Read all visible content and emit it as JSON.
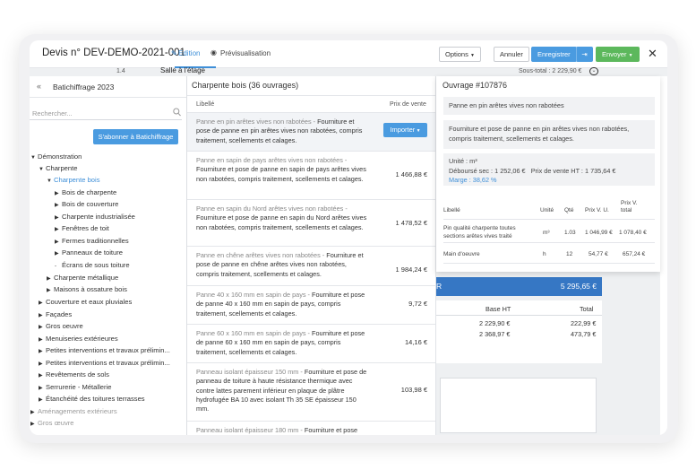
{
  "header": {
    "title": "Devis n° DEV-DEMO-2021-001",
    "tab_edit": "Edition",
    "tab_preview": "Prévisualisation",
    "options": "Options",
    "cancel": "Annuler",
    "save": "Enregistrer",
    "send": "Envoyer"
  },
  "background": {
    "line_num": "1.4",
    "section": "Salle à l'étage",
    "subtotal": "Sous-total : 2 229,90 €",
    "total_value": "5 295,65 €",
    "total_letter": "R",
    "col_base": "Base HT",
    "col_total": "Total",
    "rows": [
      {
        "base": "2 229,90 €",
        "total": "222,99 €"
      },
      {
        "base": "2 368,97 €",
        "total": "473,79 €"
      }
    ]
  },
  "library": {
    "title": "Batichiffrage 2023",
    "search_placeholder": "Rechercher...",
    "subscribe": "S'abonner à Batichiffrage",
    "tree": [
      {
        "label": "Démonstration",
        "caret": "▼",
        "level": 0
      },
      {
        "label": "Charpente",
        "caret": "▼",
        "level": 1
      },
      {
        "label": "Charpente bois",
        "caret": "▼",
        "level": 2,
        "selected": true
      },
      {
        "label": "Bois de charpente",
        "caret": "▶",
        "level": 3
      },
      {
        "label": "Bois de couverture",
        "caret": "▶",
        "level": 3
      },
      {
        "label": "Charpente industrialisée",
        "caret": "▶",
        "level": 3
      },
      {
        "label": "Fenêtres de toit",
        "caret": "▶",
        "level": 3
      },
      {
        "label": "Fermes traditionnelles",
        "caret": "▶",
        "level": 3
      },
      {
        "label": "Panneaux de toiture",
        "caret": "▶",
        "level": 3
      },
      {
        "label": "Écrans de sous toiture",
        "caret": "-",
        "level": 3
      },
      {
        "label": "Charpente métallique",
        "caret": "▶",
        "level": 2
      },
      {
        "label": "Maisons à ossature bois",
        "caret": "▶",
        "level": 2
      },
      {
        "label": "Couverture et eaux pluviales",
        "caret": "▶",
        "level": 1
      },
      {
        "label": "Façades",
        "caret": "▶",
        "level": 1
      },
      {
        "label": "Gros oeuvre",
        "caret": "▶",
        "level": 1
      },
      {
        "label": "Menuiseries extérieures",
        "caret": "▶",
        "level": 1
      },
      {
        "label": "Petites interventions et travaux prélimin...",
        "caret": "▶",
        "level": 1
      },
      {
        "label": "Petites interventions et travaux prélimin...",
        "caret": "▶",
        "level": 1
      },
      {
        "label": "Revêtements de sols",
        "caret": "▶",
        "level": 1
      },
      {
        "label": "Serrurerie - Métallerie",
        "caret": "▶",
        "level": 1
      },
      {
        "label": "Étanchéité des toitures terrasses",
        "caret": "▶",
        "level": 1
      },
      {
        "label": "Aménagements extérieurs",
        "caret": "▶",
        "level": 0,
        "dim": true
      },
      {
        "label": "Gros œuvre",
        "caret": "▶",
        "level": 0,
        "dim": true
      }
    ]
  },
  "works": {
    "title": "Charpente bois (36 ouvrages)",
    "col_label": "Libellé",
    "col_price": "Prix de vente",
    "import": "Importer",
    "items": [
      {
        "grey": "Panne en pin arêtes vives non rabotées - ",
        "text": "Fourniture et pose de panne en pin arêtes vives non rabotées, compris traitement, scellements et calages.",
        "price": ""
      },
      {
        "grey": "Panne en sapin de pays arêtes vives non rabotées - ",
        "text": "Fourniture et pose de panne en sapin de pays arêtes vives non rabotées, compris traitement, scellements et calages.",
        "price": "1 466,88 €"
      },
      {
        "grey": "Panne en sapin du Nord arêtes vives non rabotées - ",
        "text": "Fourniture et pose de panne en sapin du Nord arêtes vives non rabotées, compris traitement, scellements et calages.",
        "price": "1 478,52 €"
      },
      {
        "grey": "Panne en chêne arêtes vives non rabotées - ",
        "text": "Fourniture et pose de panne en chêne arêtes vives non rabotées, compris traitement, scellements et calages.",
        "price": "1 984,24 €"
      },
      {
        "grey": "Panne 40 x 160 mm en sapin de pays - ",
        "text": "Fourniture et pose de panne 40 x 160 mm en sapin de pays, compris traitement, scellements et calages.",
        "price": "9,72 €"
      },
      {
        "grey": "Panne 60 x 160 mm en sapin de pays - ",
        "text": "Fourniture et pose de panne 60 x 160 mm en sapin de pays, compris traitement, scellements et calages.",
        "price": "14,16 €"
      },
      {
        "grey": "Panneau isolant épaisseur 150 mm - ",
        "text": "Fourniture et pose de panneau de toiture à haute résistance thermique avec contre lattes parement inférieur en plaque de plâtre hydrofugée BA 10 avec isolant Th 35 SE épaisseur 150 mm.",
        "price": "103,98 €"
      },
      {
        "grey": "Panneau isolant épaisseur 180 mm - ",
        "text": "Fourniture et pose",
        "price": ""
      }
    ]
  },
  "detail": {
    "title": "Ouvrage #107876",
    "name": "Panne en pin arêtes vives non rabotées",
    "description": "Fourniture et pose de panne en pin arêtes vives non rabotées, compris traitement, scellements et calages.",
    "unit": "Unité : m³",
    "cost": "Déboursé sec : 1 252,06 €",
    "sale": "Prix de vente HT : 1 735,64 €",
    "margin": "Marge : 38,62 %",
    "table": {
      "headers": [
        "Libellé",
        "Unité",
        "Qté",
        "Prix V. U.",
        "Prix V.",
        "total"
      ],
      "rows": [
        {
          "label1": "Pin qualité charpente toutes",
          "label2": "sections arêtes vives traité",
          "unit": "m³",
          "qty": "1.03",
          "pu": "1 046,99 €",
          "total": "1 078,40 €"
        },
        {
          "label1": "Main d'oeuvre",
          "label2": "",
          "unit": "h",
          "qty": "12",
          "pu": "54,77 €",
          "total": "657,24 €"
        }
      ]
    }
  },
  "colors": {
    "accent": "#4a9be0",
    "send": "#5cb85c",
    "total_bar": "#3677c4"
  }
}
